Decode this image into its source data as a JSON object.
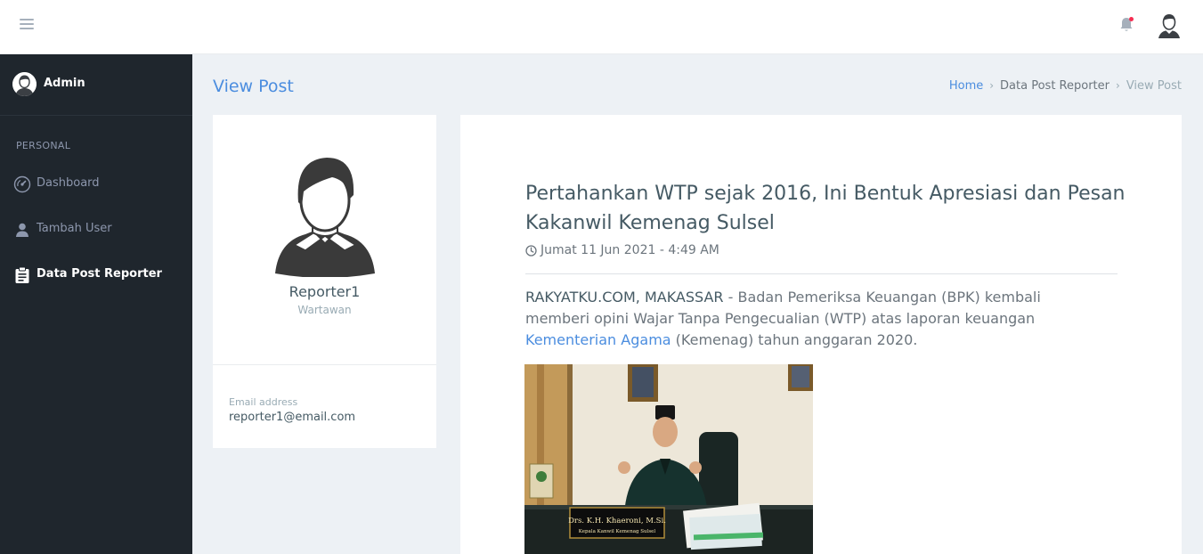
{
  "topbar": {
    "menu_icon": "hamburger-icon",
    "notification_icon": "bell-icon",
    "avatar_icon": "user-avatar-icon"
  },
  "sidebar": {
    "user": {
      "name": "Admin"
    },
    "section_label": "PERSONAL",
    "items": [
      {
        "label": "Dashboard",
        "icon": "speedometer-icon",
        "active": false
      },
      {
        "label": "Tambah User",
        "icon": "user-icon",
        "active": false
      },
      {
        "label": "Data Post Reporter",
        "icon": "clipboard-icon",
        "active": true
      }
    ]
  },
  "page": {
    "title": "View Post",
    "breadcrumb": [
      "Home",
      "Data Post Reporter",
      "View Post"
    ]
  },
  "profile": {
    "name": "Reporter1",
    "role": "Wartawan",
    "email_label": "Email address",
    "email": "reporter1@email.com"
  },
  "article": {
    "title": "Pertahankan WTP sejak 2016, Ini Bentuk Apresiasi dan Pesan Kakanwil Kemenag Sulsel",
    "date": "Jumat 11 Jun 2021 - 4:49 AM",
    "source": "RAKYATKU.COM, MAKASSAR",
    "lead_1": " - Badan Pemeriksa Keuangan (BPK) kembali memberi opini Wajar Tanpa Pengecualian (WTP) atas laporan keuangan ",
    "link_text": "Kementerian Agama",
    "lead_2": " (Kemenag) tahun anggaran 2020.",
    "nameplate_line1": "Drs. K.H. Khaeroni, M.Si.",
    "nameplate_line2": "Kepala Kanwil Kemenag Sulsel"
  },
  "colors": {
    "sidebar_bg": "#1f262d",
    "page_bg": "#edf1f5",
    "accent": "#4b8ddf",
    "notification_dot": "#f62d51"
  }
}
